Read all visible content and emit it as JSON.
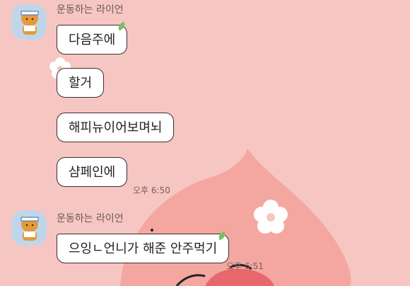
{
  "messages_group_1": {
    "sender": "운동하는 라이언",
    "bubbles": [
      "다음주에",
      "할거",
      "해피뉴이어보며뇌",
      "샴페인에"
    ],
    "time": "오후 6:50"
  },
  "messages_group_2": {
    "sender": "운동하는 라이언",
    "bubbles": [
      "으잉ㄴ언니가 해준 안주먹기"
    ],
    "time": "오후 6:51"
  },
  "colors": {
    "background": "#f6c6c2",
    "bubble": "#ffffff",
    "accent_leaf": "#78c06a"
  }
}
